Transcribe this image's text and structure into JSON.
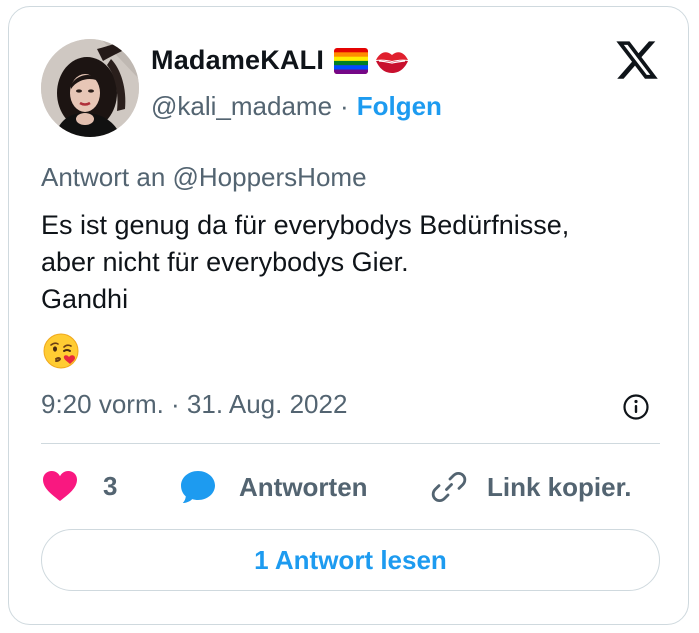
{
  "user": {
    "display_name": "MadameKALI",
    "handle": "@kali_madame",
    "separator": "·",
    "follow_label": "Folgen"
  },
  "tweet": {
    "reply_to": "Antwort an @HoppersHome",
    "lines": [
      "Es ist genug da für everybodys Bedürfnisse,",
      "aber nicht für everybodys Gier.",
      "Gandhi"
    ],
    "emoji": "winking-face-throwing-kiss",
    "timestamp": "9:20 vorm. · 31. Aug. 2022"
  },
  "actions": {
    "like_count": "3",
    "reply_label": "Antworten",
    "copy_label": "Link kopier."
  },
  "read_replies_label": "1 Antwort lesen",
  "icons": [
    "rainbow-flag-icon",
    "kiss-mark-icon",
    "x-logo-icon",
    "info-icon",
    "heart-icon",
    "reply-bubble-icon",
    "link-icon"
  ],
  "colors": {
    "accent": "#1d9bf0",
    "like": "#f91880",
    "secondary_text": "#536471",
    "border": "#cfd9de"
  }
}
